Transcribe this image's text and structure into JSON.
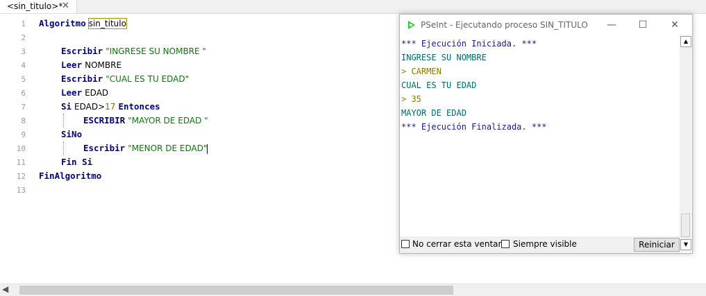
{
  "tab": {
    "title": "<sin_titulo>*",
    "close": "✕"
  },
  "editor": {
    "line_numbers": [
      "1",
      "2",
      "3",
      "4",
      "5",
      "6",
      "7",
      "8",
      "9",
      "10",
      "11",
      "12",
      "13"
    ],
    "l1": {
      "kw": "Algoritmo",
      "name": "sin_titulo"
    },
    "l3": {
      "kw": "Escribir",
      "str": "\"INGRESE SU NOMBRE \""
    },
    "l4": {
      "kw": "Leer",
      "id": "NOMBRE"
    },
    "l5": {
      "kw": "Escribir",
      "str": "\"CUAL ES TU EDAD\""
    },
    "l6": {
      "kw": "Leer",
      "id": "EDAD"
    },
    "l7": {
      "kw": "Si",
      "id": "EDAD>",
      "num": "17",
      "kw2": "Entonces"
    },
    "l8": {
      "kw": "ESCRIBIR",
      "str": "\"MAYOR DE EDAD \""
    },
    "l9": {
      "kw": "SiNo"
    },
    "l10": {
      "kw": "Escribir",
      "str": "\"MENOR DE EDAD\""
    },
    "l11": {
      "kw": "Fin Si"
    },
    "l12": {
      "kw": "FinAlgoritmo"
    }
  },
  "run_window": {
    "title": "PSeInt - Ejecutando proceso SIN_TITULO",
    "minimize": "—",
    "maximize": "☐",
    "close": "✕",
    "console": [
      "*** Ejecución Iniciada. ***",
      "INGRESE SU NOMBRE",
      "> CARMEN",
      "CUAL ES TU EDAD",
      "> 35",
      "MAYOR DE EDAD",
      "*** Ejecución Finalizada. ***"
    ],
    "no_cerrar_label": "No cerrar esta ventana",
    "siempre_visible_label": "Siempre visible",
    "reiniciar_label": "Reiniciar"
  },
  "colors": {
    "keyword": "#00007f",
    "string": "#007f00",
    "number": "#a06000",
    "pseint_icon": "#2ec52e"
  }
}
